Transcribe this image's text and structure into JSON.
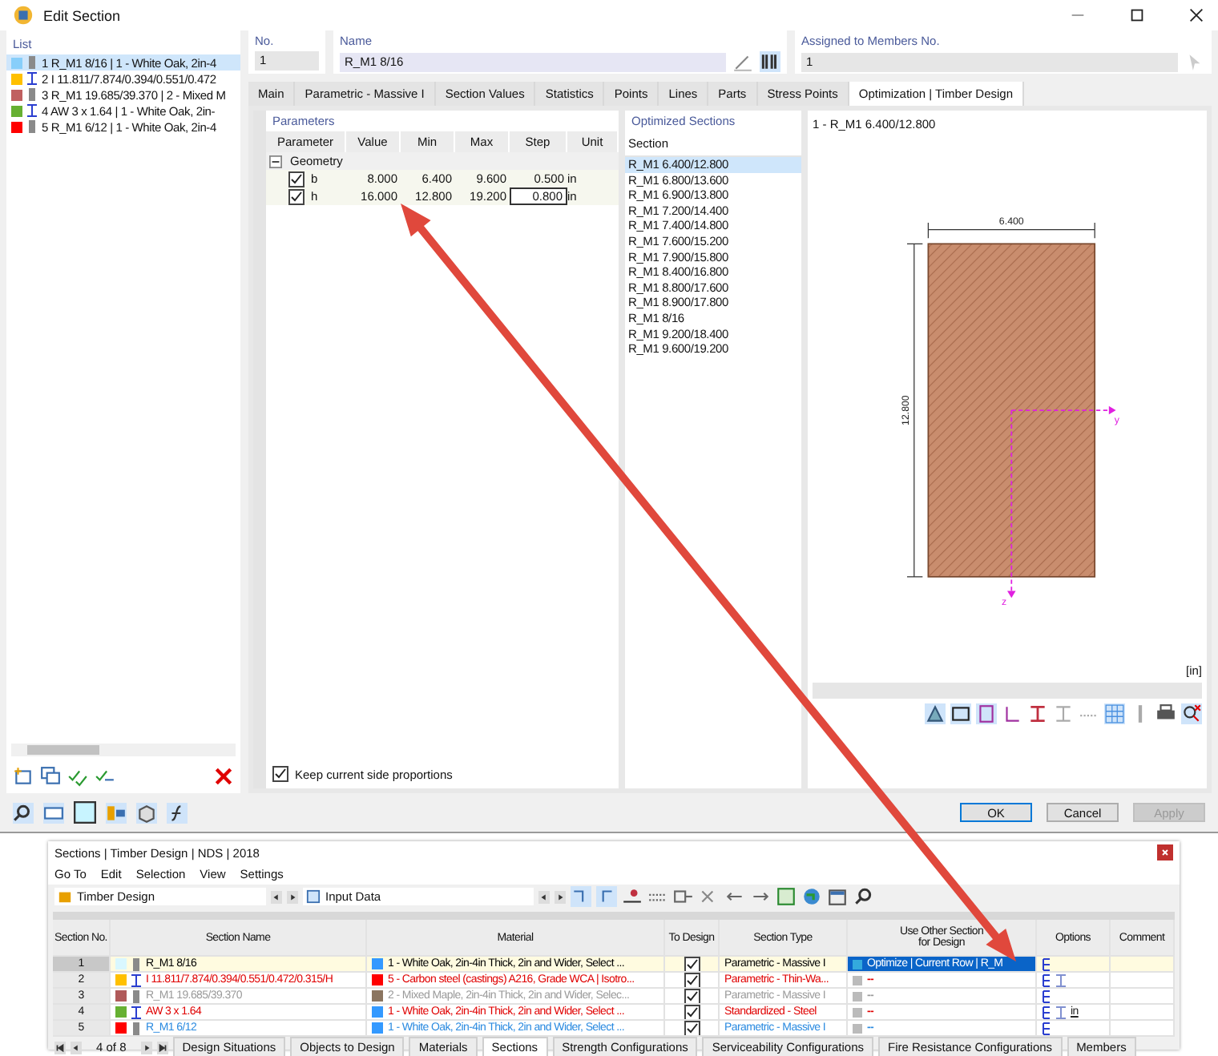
{
  "window": {
    "title": "Edit Section"
  },
  "list": {
    "title": "List",
    "items": [
      {
        "no": "1",
        "text": "R_M1 8/16 | 1 - White Oak, 2in-4",
        "color": "#87cefa",
        "kind": "bar",
        "selected": true
      },
      {
        "no": "2",
        "text": "I 11.811/7.874/0.394/0.551/0.472",
        "color": "#ffc000",
        "kind": "ibeam",
        "selected": false
      },
      {
        "no": "3",
        "text": "R_M1 19.685/39.370 | 2 - Mixed M",
        "color": "#c06060",
        "kind": "bar",
        "selected": false
      },
      {
        "no": "4",
        "text": "AW 3 x 1.64 | 1 - White Oak, 2in-",
        "color": "#66b032",
        "kind": "ibeam",
        "selected": false
      },
      {
        "no": "5",
        "text": "R_M1 6/12 | 1 - White Oak, 2in-4",
        "color": "#ff0000",
        "kind": "bar",
        "selected": false
      }
    ]
  },
  "header": {
    "no": {
      "label": "No.",
      "value": "1"
    },
    "name": {
      "label": "Name",
      "value": "R_M1 8/16"
    },
    "assigned": {
      "label": "Assigned to Members No.",
      "value": "1"
    }
  },
  "tabs": [
    {
      "label": "Main",
      "selected": false
    },
    {
      "label": "Parametric - Massive I",
      "selected": false
    },
    {
      "label": "Section Values",
      "selected": false
    },
    {
      "label": "Statistics",
      "selected": false
    },
    {
      "label": "Points",
      "selected": false
    },
    {
      "label": "Lines",
      "selected": false
    },
    {
      "label": "Parts",
      "selected": false
    },
    {
      "label": "Stress Points",
      "selected": false
    },
    {
      "label": "Optimization | Timber Design",
      "selected": true
    }
  ],
  "parameters": {
    "title": "Parameters",
    "columns": [
      "Parameter",
      "Value",
      "Min",
      "Max",
      "Step",
      "Unit"
    ],
    "group": "Geometry",
    "expanded": true,
    "rows": [
      {
        "name": "b",
        "checked": true,
        "value": "8.000",
        "min": "6.400",
        "max": "9.600",
        "step": "0.500",
        "unit": "in"
      },
      {
        "name": "h",
        "checked": true,
        "value": "16.000",
        "min": "12.800",
        "max": "19.200",
        "step": "0.800",
        "unit": "in"
      }
    ],
    "keep": {
      "label": "Keep current side proportions",
      "checked": true
    }
  },
  "optimized": {
    "title": "Optimized Sections",
    "column": "Section",
    "items": [
      {
        "text": "R_M1 6.400/12.800",
        "selected": true
      },
      {
        "text": "R_M1 6.800/13.600",
        "selected": false
      },
      {
        "text": "R_M1 6.900/13.800",
        "selected": false
      },
      {
        "text": "R_M1 7.200/14.400",
        "selected": false
      },
      {
        "text": "R_M1 7.400/14.800",
        "selected": false
      },
      {
        "text": "R_M1 7.600/15.200",
        "selected": false
      },
      {
        "text": "R_M1 7.900/15.800",
        "selected": false
      },
      {
        "text": "R_M1 8.400/16.800",
        "selected": false
      },
      {
        "text": "R_M1 8.800/17.600",
        "selected": false
      },
      {
        "text": "R_M1 8.900/17.800",
        "selected": false
      },
      {
        "text": "R_M1 8/16",
        "selected": false
      },
      {
        "text": "R_M1 9.200/18.400",
        "selected": false
      },
      {
        "text": "R_M1 9.600/19.200",
        "selected": false
      }
    ]
  },
  "preview": {
    "title": "1 - R_M1 6.400/12.800",
    "width_label": "6.400",
    "height_label": "12.800",
    "y_axis": "y",
    "z_axis": "z",
    "unit": "[in]"
  },
  "buttons": [
    {
      "label": "OK",
      "disabled": false
    },
    {
      "label": "Cancel",
      "disabled": false
    },
    {
      "label": "Apply",
      "disabled": true
    }
  ],
  "sections": {
    "title": "Sections | Timber Design | NDS | 2018",
    "menu": [
      "Go To",
      "Edit",
      "Selection",
      "View",
      "Settings"
    ],
    "combo_1": "Timber Design",
    "combo_2": "Input Data",
    "columns": [
      "Section No.",
      "Section Name",
      "Material",
      "To Design",
      "Section Type",
      "Use Other Section for Design",
      "Options",
      "Comment"
    ],
    "rows": [
      {
        "no": "1",
        "swatch": {
          "color": "#d9f7ff"
        },
        "icon": {
          "kind": "bar"
        },
        "name": {
          "text": "R_M1 8/16",
          "color": "#000000"
        },
        "material": {
          "swatch": {
            "color": "#3399ff"
          },
          "text": "1 - White Oak, 2in-4in Thick, 2in and Wider, Select ...",
          "color": "#000000"
        },
        "to_design": true,
        "type": {
          "text": "Parametric - Massive I",
          "color": "#000000"
        },
        "use_other": {
          "kind": "optimize",
          "text": "Optimize | Current Row | R_M"
        },
        "options": [
          {
            "kind": "flag"
          }
        ],
        "selected": true
      },
      {
        "no": "2",
        "swatch": {
          "color": "#ffc000"
        },
        "icon": {
          "kind": "ibeam"
        },
        "name": {
          "text": "I 11.811/7.874/0.394/0.551/0.472/0.315/H",
          "color": "#e00000"
        },
        "material": {
          "swatch": {
            "color": "#ff0000"
          },
          "text": "5 - Carbon steel (castings) A216, Grade WCA | Isotro...",
          "color": "#e00000"
        },
        "to_design": true,
        "type": {
          "text": "Parametric - Thin-Wa...",
          "color": "#e00000"
        },
        "use_other": {
          "kind": "none",
          "text": "--",
          "color": "#e00000"
        },
        "options": [
          {
            "kind": "flag"
          },
          {
            "kind": "ibeam"
          }
        ],
        "selected": false
      },
      {
        "no": "3",
        "swatch": {
          "color": "#b05a5a"
        },
        "icon": {
          "kind": "bar"
        },
        "name": {
          "text": "R_M1 19.685/39.370",
          "color": "#9a9a9a"
        },
        "material": {
          "swatch": {
            "color": "#8b7560"
          },
          "text": "2 - Mixed Maple, 2in-4in Thick, 2in and Wider, Selec...",
          "color": "#9a9a9a"
        },
        "to_design": true,
        "type": {
          "text": "Parametric - Massive I",
          "color": "#9a9a9a"
        },
        "use_other": {
          "kind": "none",
          "text": "--",
          "color": "#9a9a9a"
        },
        "options": [
          {
            "kind": "flag"
          }
        ],
        "selected": false
      },
      {
        "no": "4",
        "swatch": {
          "color": "#66b032"
        },
        "icon": {
          "kind": "ibeam"
        },
        "name": {
          "text": "AW 3 x 1.64",
          "color": "#e00000"
        },
        "material": {
          "swatch": {
            "color": "#3399ff"
          },
          "text": "1 - White Oak, 2in-4in Thick, 2in and Wider, Select ...",
          "color": "#e00000"
        },
        "to_design": true,
        "type": {
          "text": "Standardized - Steel",
          "color": "#e00000"
        },
        "use_other": {
          "kind": "none",
          "text": "--",
          "color": "#e00000"
        },
        "options": [
          {
            "kind": "flag"
          },
          {
            "kind": "ibeam"
          },
          {
            "kind": "text",
            "text": "in"
          }
        ],
        "selected": false
      },
      {
        "no": "5",
        "swatch": {
          "color": "#ff0000"
        },
        "icon": {
          "kind": "bar"
        },
        "name": {
          "text": "R_M1 6/12",
          "color": "#2a8ae0"
        },
        "material": {
          "swatch": {
            "color": "#3399ff"
          },
          "text": "1 - White Oak, 2in-4in Thick, 2in and Wider, Select ...",
          "color": "#2a8ae0"
        },
        "to_design": true,
        "type": {
          "text": "Parametric - Massive I",
          "color": "#2a8ae0"
        },
        "use_other": {
          "kind": "none",
          "text": "--",
          "color": "#2a8ae0"
        },
        "options": [
          {
            "kind": "flag"
          }
        ],
        "selected": false
      }
    ],
    "pager": "4 of 8",
    "tabs": [
      {
        "label": "Design Situations",
        "selected": false
      },
      {
        "label": "Objects to Design",
        "selected": false
      },
      {
        "label": "Materials",
        "selected": false
      },
      {
        "label": "Sections",
        "selected": true
      },
      {
        "label": "Strength Configurations",
        "selected": false
      },
      {
        "label": "Serviceability Configurations",
        "selected": false
      },
      {
        "label": "Fire Resistance Configurations",
        "selected": false
      },
      {
        "label": "Members",
        "selected": false
      }
    ]
  }
}
